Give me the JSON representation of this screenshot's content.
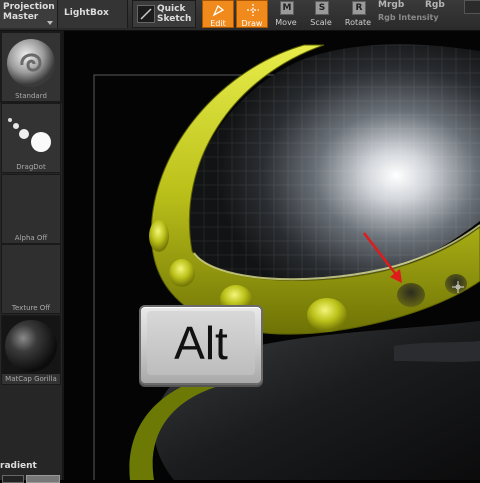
{
  "toolbar": {
    "projection_master": [
      "Projection",
      "Master"
    ],
    "lightbox": "LightBox",
    "quick_sketch": [
      "Quick",
      "Sketch"
    ],
    "tools": {
      "edit": "Edit",
      "draw": "Draw",
      "move": "Move",
      "scale": "Scale",
      "rotate": "Rotate"
    },
    "tool_letters": {
      "move": "M",
      "scale": "S",
      "rotate": "R"
    },
    "mrgb": "Mrgb",
    "rgb": "Rgb",
    "rgb_intensity": "Rgb Intensity",
    "colors": {
      "active_tool": "#f08a1c"
    }
  },
  "tray": {
    "brush": "Standard",
    "stroke": "DragDot",
    "alpha": "Alpha Off",
    "texture": "Texture Off",
    "material": "MatCap Gorilla",
    "gradient": "radient"
  },
  "canvas": {
    "key_overlay": "Alt",
    "colors": {
      "ring": "#bcc21a",
      "arrow": "#e01b1b"
    }
  }
}
